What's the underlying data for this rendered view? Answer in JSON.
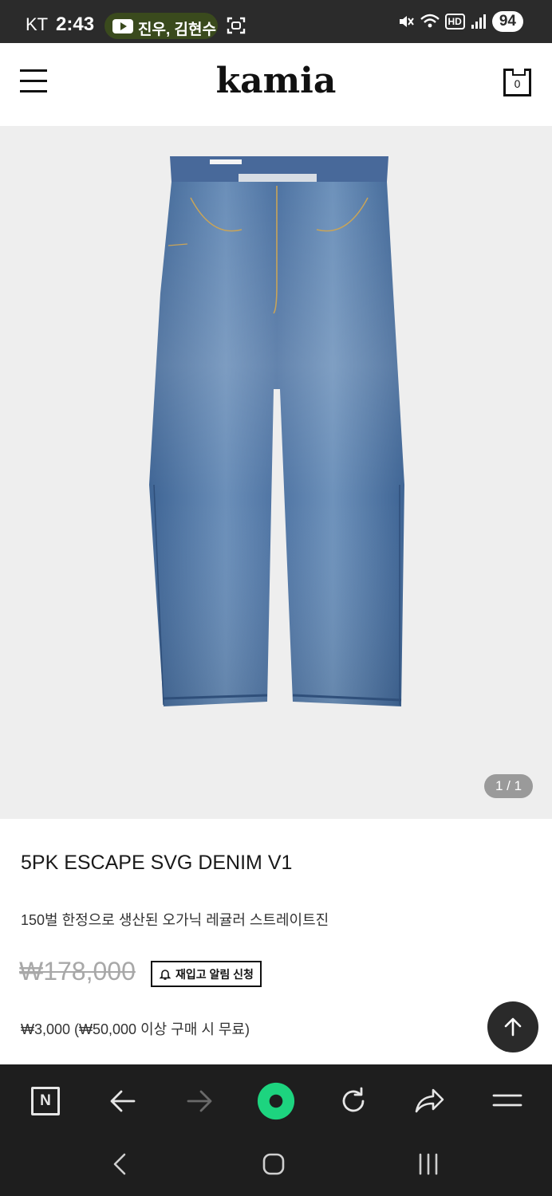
{
  "status_bar": {
    "carrier": "KT",
    "time": "2:43",
    "notification_text": "진우, 김현수",
    "battery": "94",
    "network_badge": "HD",
    "icons": [
      "youtube-icon",
      "screenshot-icon",
      "mute-icon",
      "wifi-icon",
      "signal-icon"
    ]
  },
  "header": {
    "logo": "kamia",
    "cart_count": "0",
    "icons": [
      "hamburger-menu-icon",
      "cart-bag-icon"
    ]
  },
  "gallery": {
    "page_indicator": "1 / 1",
    "image_subject": "blue denim jeans"
  },
  "product": {
    "title": "5PK ESCAPE SVG DENIM V1",
    "description": "150벌 한정으로 생산된 오가닉 레귤러 스트레이트진",
    "price": "₩178,000",
    "restock_button": "재입고 알림 신청",
    "shipping": "₩3,000 (₩50,000 이상 구매 시 무료)"
  },
  "browser_toolbar": {
    "n_label": "N",
    "icons": [
      "naver-n-icon",
      "back-arrow-icon",
      "forward-arrow-icon",
      "home-circle-icon",
      "refresh-icon",
      "share-icon",
      "menu-icon"
    ]
  },
  "system_nav": {
    "icons": [
      "system-back-icon",
      "system-home-icon",
      "system-recents-icon"
    ]
  },
  "colors": {
    "status_bar": "#2b2b2b",
    "hero_bg": "#eeeeee",
    "browser_bar": "#1e1e1e",
    "home_button_accent": "#1dd47f",
    "denim": "#4a6f9f"
  }
}
